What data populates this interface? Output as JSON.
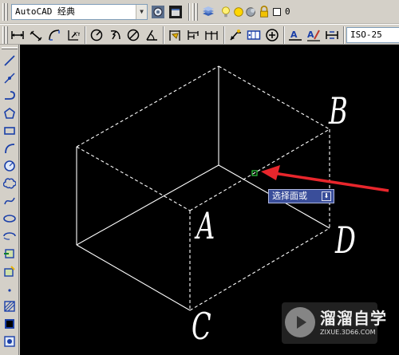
{
  "toolbar_top": {
    "workspace_value": "AutoCAD 经典",
    "layer_value": "0",
    "icons": [
      "workspace-settings-icon",
      "my-workspace-icon",
      "layer-manager-icon",
      "bulb-on-icon",
      "sun-freeze-icon",
      "lock-icon",
      "color-square-icon"
    ]
  },
  "toolbar_dimension": {
    "dimstyle_value": "ISO-25",
    "icons": [
      "linear-dim-icon",
      "aligned-dim-icon",
      "arc-length-icon",
      "ordinate-dim-icon",
      "radius-dim-icon",
      "jogged-dim-icon",
      "diameter-dim-icon",
      "angular-dim-icon",
      "quick-dim-icon",
      "baseline-dim-icon",
      "continue-dim-icon",
      "quick-leader-icon",
      "tolerance-icon",
      "center-mark-icon",
      "dim-edit-icon",
      "dim-text-edit-icon",
      "dim-update-icon"
    ]
  },
  "draw_toolbar": {
    "icons": [
      "line-icon",
      "construction-line-icon",
      "polyline-icon",
      "polygon-icon",
      "rectangle-icon",
      "arc-icon",
      "circle-icon",
      "revision-cloud-icon",
      "spline-icon",
      "ellipse-icon",
      "ellipse-arc-icon",
      "insert-block-icon",
      "make-block-icon",
      "point-icon",
      "hatch-icon",
      "gradient-icon",
      "region-icon"
    ]
  },
  "drawing": {
    "vertex_labels": {
      "a": "A",
      "b": "B",
      "c": "C",
      "d": "D"
    },
    "tooltip_text": "选择面或",
    "line_color": "#ffffff",
    "arrow_color": "#e8262c",
    "snap_color": "#2ecc40"
  },
  "watermark": {
    "title": "溜溜自学",
    "url": "ZIXUE.3D66.COM"
  }
}
